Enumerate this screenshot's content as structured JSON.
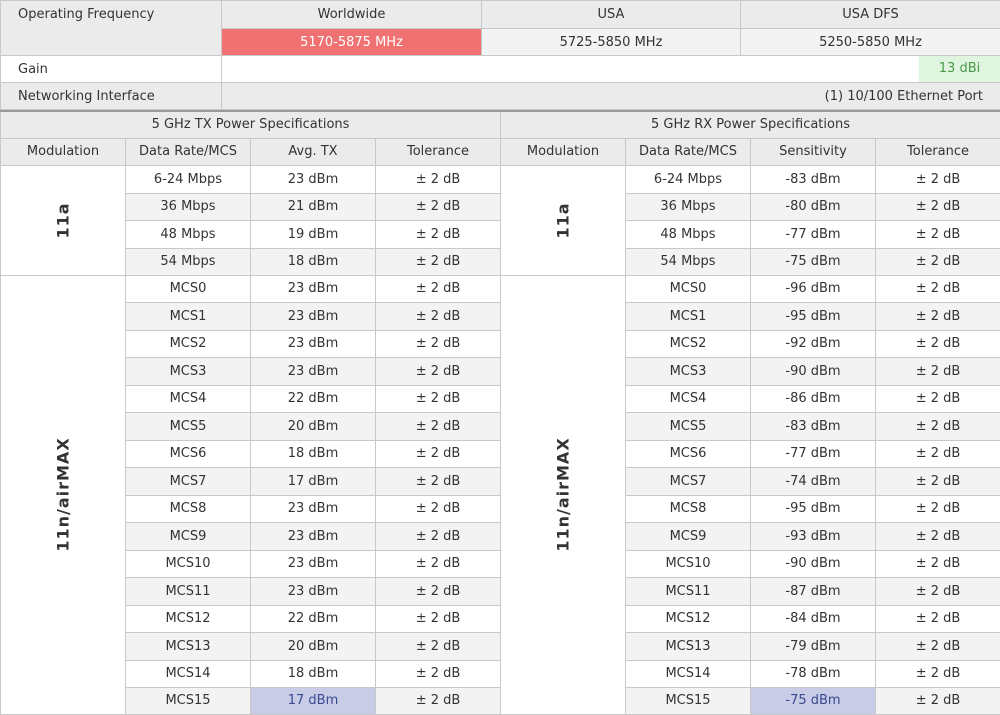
{
  "freq": {
    "label": "Operating Frequency",
    "worldwide": "Worldwide",
    "usa": "USA",
    "usa_dfs": "USA DFS",
    "worldwide_val": "5170-5875 MHz",
    "usa_val": "5725-5850 MHz",
    "usa_dfs_val": "5250-5850 MHz"
  },
  "gain": {
    "label": "Gain",
    "value": "13 dBi"
  },
  "net": {
    "label": "Networking Interface",
    "value": "(1) 10/100 Ethernet Port"
  },
  "tx_title": "5 GHz TX Power Specifications",
  "rx_title": "5 GHz RX Power Specifications",
  "headers": {
    "modulation": "Modulation",
    "rate": "Data Rate/MCS",
    "avg_tx": "Avg. TX",
    "tolerance": "Tolerance",
    "sensitivity": "Sensitivity"
  },
  "groups": {
    "a": "11a",
    "n": "11n/airMAX"
  },
  "rows": [
    {
      "rate": "6-24 Mbps",
      "tx": "23 dBm",
      "txtol": "± 2 dB",
      "rxrate": "6-24 Mbps",
      "rx": "-83 dBm",
      "rxtol": "± 2 dB"
    },
    {
      "rate": "36 Mbps",
      "tx": "21 dBm",
      "txtol": "± 2 dB",
      "rxrate": "36 Mbps",
      "rx": "-80 dBm",
      "rxtol": "± 2 dB"
    },
    {
      "rate": "48 Mbps",
      "tx": "19 dBm",
      "txtol": "± 2 dB",
      "rxrate": "48 Mbps",
      "rx": "-77 dBm",
      "rxtol": "± 2 dB"
    },
    {
      "rate": "54 Mbps",
      "tx": "18 dBm",
      "txtol": "± 2 dB",
      "rxrate": "54 Mbps",
      "rx": "-75 dBm",
      "rxtol": "± 2 dB"
    },
    {
      "rate": "MCS0",
      "tx": "23 dBm",
      "txtol": "± 2 dB",
      "rxrate": "MCS0",
      "rx": "-96 dBm",
      "rxtol": "± 2 dB"
    },
    {
      "rate": "MCS1",
      "tx": "23 dBm",
      "txtol": "± 2 dB",
      "rxrate": "MCS1",
      "rx": "-95 dBm",
      "rxtol": "± 2 dB"
    },
    {
      "rate": "MCS2",
      "tx": "23 dBm",
      "txtol": "± 2 dB",
      "rxrate": "MCS2",
      "rx": "-92 dBm",
      "rxtol": "± 2 dB"
    },
    {
      "rate": "MCS3",
      "tx": "23 dBm",
      "txtol": "± 2 dB",
      "rxrate": "MCS3",
      "rx": "-90 dBm",
      "rxtol": "± 2 dB"
    },
    {
      "rate": "MCS4",
      "tx": "22 dBm",
      "txtol": "± 2 dB",
      "rxrate": "MCS4",
      "rx": "-86 dBm",
      "rxtol": "± 2 dB"
    },
    {
      "rate": "MCS5",
      "tx": "20 dBm",
      "txtol": "± 2 dB",
      "rxrate": "MCS5",
      "rx": "-83 dBm",
      "rxtol": "± 2 dB"
    },
    {
      "rate": "MCS6",
      "tx": "18 dBm",
      "txtol": "± 2 dB",
      "rxrate": "MCS6",
      "rx": "-77 dBm",
      "rxtol": "± 2 dB"
    },
    {
      "rate": "MCS7",
      "tx": "17 dBm",
      "txtol": "± 2 dB",
      "rxrate": "MCS7",
      "rx": "-74 dBm",
      "rxtol": "± 2 dB"
    },
    {
      "rate": "MCS8",
      "tx": "23 dBm",
      "txtol": "± 2 dB",
      "rxrate": "MCS8",
      "rx": "-95 dBm",
      "rxtol": "± 2 dB"
    },
    {
      "rate": "MCS9",
      "tx": "23 dBm",
      "txtol": "± 2 dB",
      "rxrate": "MCS9",
      "rx": "-93 dBm",
      "rxtol": "± 2 dB"
    },
    {
      "rate": "MCS10",
      "tx": "23 dBm",
      "txtol": "± 2 dB",
      "rxrate": "MCS10",
      "rx": "-90 dBm",
      "rxtol": "± 2 dB"
    },
    {
      "rate": "MCS11",
      "tx": "23 dBm",
      "txtol": "± 2 dB",
      "rxrate": "MCS11",
      "rx": "-87 dBm",
      "rxtol": "± 2 dB"
    },
    {
      "rate": "MCS12",
      "tx": "22 dBm",
      "txtol": "± 2 dB",
      "rxrate": "MCS12",
      "rx": "-84 dBm",
      "rxtol": "± 2 dB"
    },
    {
      "rate": "MCS13",
      "tx": "20 dBm",
      "txtol": "± 2 dB",
      "rxrate": "MCS13",
      "rx": "-79 dBm",
      "rxtol": "± 2 dB"
    },
    {
      "rate": "MCS14",
      "tx": "18 dBm",
      "txtol": "± 2 dB",
      "rxrate": "MCS14",
      "rx": "-78 dBm",
      "rxtol": "± 2 dB"
    },
    {
      "rate": "MCS15",
      "tx": "17 dBm",
      "txtol": "± 2 dB",
      "rxrate": "MCS15",
      "rx": "-75 dBm",
      "rxtol": "± 2 dB"
    }
  ]
}
